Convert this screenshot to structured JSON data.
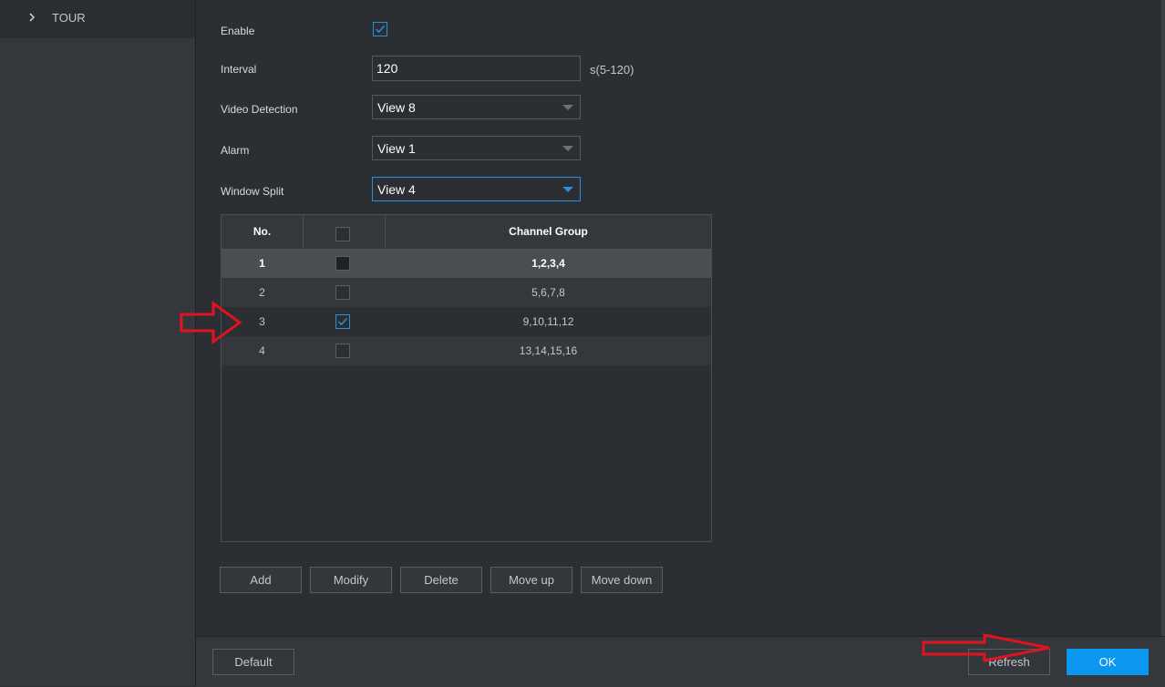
{
  "sidebar": {
    "items": [
      {
        "label": "TOUR",
        "icon": "chevron-right-icon"
      }
    ]
  },
  "form": {
    "enable": {
      "label": "Enable",
      "checked": true
    },
    "interval": {
      "label": "Interval",
      "value": "120",
      "unit": "s(5-120)"
    },
    "video_detection": {
      "label": "Video Detection",
      "value": "View 8"
    },
    "alarm": {
      "label": "Alarm",
      "value": "View 1"
    },
    "window_split": {
      "label": "Window Split",
      "value": "View 4"
    }
  },
  "table": {
    "headers": {
      "no": "No.",
      "channel_group": "Channel Group"
    },
    "rows": [
      {
        "no": "1",
        "channel_group": "1,2,3,4",
        "checked": false,
        "selected": true
      },
      {
        "no": "2",
        "channel_group": "5,6,7,8",
        "checked": false,
        "selected": false
      },
      {
        "no": "3",
        "channel_group": "9,10,11,12",
        "checked": true,
        "selected": false
      },
      {
        "no": "4",
        "channel_group": "13,14,15,16",
        "checked": false,
        "selected": false
      }
    ]
  },
  "actions": {
    "add": "Add",
    "modify": "Modify",
    "delete": "Delete",
    "move_up": "Move up",
    "move_down": "Move down"
  },
  "footer": {
    "default": "Default",
    "refresh": "Refresh",
    "ok": "OK"
  },
  "colors": {
    "accent": "#0b96f0",
    "annotation_arrow": "#e0141e",
    "background": "#2b2e33"
  }
}
